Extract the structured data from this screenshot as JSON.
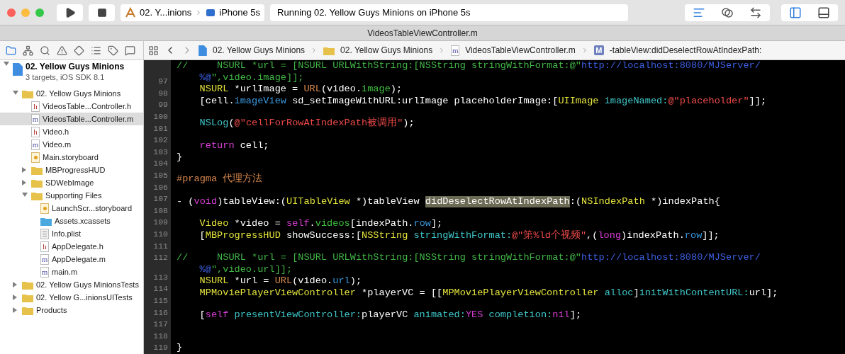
{
  "toolbar": {
    "scheme": "02. Y...inions",
    "device": "iPhone 5s",
    "status": "Running 02. Yellow Guys Minions on iPhone 5s",
    "editor_modes": [
      {
        "kind": "standard",
        "selected": true
      },
      {
        "kind": "assistant",
        "selected": false
      },
      {
        "kind": "version",
        "selected": false
      }
    ],
    "panels": [
      {
        "kind": "navigator",
        "on": true
      },
      {
        "kind": "debug",
        "on": false
      }
    ]
  },
  "window": {
    "title": "VideosTableViewController.m"
  },
  "navigator_tabs": [
    {
      "kind": "project",
      "selected": true
    },
    {
      "kind": "symbols",
      "selected": false
    },
    {
      "kind": "find",
      "selected": false
    },
    {
      "kind": "issues",
      "selected": false
    },
    {
      "kind": "tests",
      "selected": false
    },
    {
      "kind": "debug",
      "selected": false
    },
    {
      "kind": "breakpoints",
      "selected": false
    },
    {
      "kind": "reports",
      "selected": false
    }
  ],
  "project": {
    "name": "02. Yellow Guys Minions",
    "subtitle": "3 targets, iOS SDK 8.1",
    "expanded": true,
    "children": [
      {
        "kind": "folder",
        "name": "02. Yellow Guys Minions",
        "expanded": true,
        "selected": false,
        "children": [
          {
            "kind": "file",
            "letter": "h",
            "name": "VideosTable...Controller.h",
            "selected": false
          },
          {
            "kind": "file",
            "letter": "m",
            "name": "VideosTable...Controller.m",
            "selected": true
          },
          {
            "kind": "file",
            "letter": "h",
            "name": "Video.h",
            "selected": false
          },
          {
            "kind": "file",
            "letter": "m",
            "name": "Video.m",
            "selected": false
          },
          {
            "kind": "storyboard",
            "name": "Main.storyboard",
            "selected": false
          },
          {
            "kind": "folder",
            "name": "MBProgressHUD",
            "expanded": false,
            "selected": false
          },
          {
            "kind": "folder",
            "name": "SDWebImage",
            "expanded": false,
            "selected": false
          },
          {
            "kind": "folder",
            "name": "Supporting Files",
            "expanded": true,
            "selected": false,
            "children": [
              {
                "kind": "storyboard",
                "name": "LaunchScr...storyboard",
                "selected": false
              },
              {
                "kind": "assets",
                "name": "Assets.xcassets",
                "selected": false
              },
              {
                "kind": "plist",
                "name": "Info.plist",
                "selected": false
              },
              {
                "kind": "file",
                "letter": "h",
                "name": "AppDelegate.h",
                "selected": false
              },
              {
                "kind": "file",
                "letter": "m",
                "name": "AppDelegate.m",
                "selected": false
              },
              {
                "kind": "file",
                "letter": "m",
                "name": "main.m",
                "selected": false
              }
            ]
          }
        ]
      },
      {
        "kind": "folder",
        "name": "02. Yellow Guys MinionsTests",
        "expanded": false,
        "selected": false
      },
      {
        "kind": "folder",
        "name": "02. Yellow G...inionsUITests",
        "expanded": false,
        "selected": false
      },
      {
        "kind": "folder",
        "name": "Products",
        "expanded": false,
        "selected": false
      }
    ]
  },
  "jump_bar": [
    {
      "kind": "project",
      "text": "02. Yellow Guys Minions"
    },
    {
      "kind": "folder",
      "text": "02. Yellow Guys Minions"
    },
    {
      "kind": "file",
      "letter": "m",
      "text": "VideosTableViewController.m"
    },
    {
      "kind": "method",
      "letter": "M",
      "text": "-tableView:didDeselectRowAtIndexPath:"
    }
  ],
  "code": [
    {
      "tokens": [
        {
          "kind": "comment",
          "text": "//     NSURL *url = [NSURL URLWithString:[NSString stringWithFormat:@\""
        },
        {
          "kind": "url",
          "text": "http://localhost:8080/MJServer/"
        }
      ],
      "continuation": [
        {
          "kind": "url",
          "text": "%@"
        },
        {
          "kind": "comment",
          "text": "\",video.image]];"
        }
      ]
    },
    {
      "number": "97",
      "indented": true,
      "tokens": [
        {
          "kind": "type",
          "text": "NSURL"
        },
        {
          "kind": "plain",
          "text": " *urlImage = "
        },
        {
          "kind": "macro",
          "text": "URL"
        },
        {
          "kind": "plain",
          "text": "(video."
        },
        {
          "kind": "member",
          "text": "image"
        },
        {
          "kind": "plain",
          "text": ");"
        }
      ]
    },
    {
      "number": "98",
      "indented": true,
      "tokens": [
        {
          "kind": "plain",
          "text": "[cell."
        },
        {
          "kind": "property",
          "text": "imageView"
        },
        {
          "kind": "plain",
          "text": " sd_setImageWithURL:urlImage placeholderImage:["
        },
        {
          "kind": "type",
          "text": "UIImage "
        },
        {
          "kind": "method",
          "text": "imageNamed:"
        },
        {
          "kind": "string",
          "text": "@\"placeholder\""
        },
        {
          "kind": "plain",
          "text": "]];"
        }
      ]
    },
    {
      "number": "99"
    },
    {
      "number": "100",
      "indented": true,
      "tokens": [
        {
          "kind": "method",
          "text": "NSLog"
        },
        {
          "kind": "plain",
          "text": "("
        },
        {
          "kind": "string",
          "text": "@\"cellForRowAtIndexPath被调用\""
        },
        {
          "kind": "plain",
          "text": ");"
        }
      ]
    },
    {
      "number": "101"
    },
    {
      "number": "102",
      "indented": true,
      "tokens": [
        {
          "kind": "keyword",
          "text": "return"
        },
        {
          "kind": "plain",
          "text": " cell;"
        }
      ]
    },
    {
      "number": "103",
      "tokens": [
        {
          "kind": "plain",
          "text": "}"
        }
      ]
    },
    {
      "number": "104"
    },
    {
      "number": "105",
      "tokens": [
        {
          "kind": "pragma",
          "text": "#pragma 代理方法"
        }
      ]
    },
    {
      "number": "106"
    },
    {
      "number": "107",
      "tokens": [
        {
          "kind": "plain",
          "text": "- ("
        },
        {
          "kind": "keyword",
          "text": "void"
        },
        {
          "kind": "plain",
          "text": ")tableView:("
        },
        {
          "kind": "type",
          "text": "UITableView"
        },
        {
          "kind": "plain",
          "text": " *)tableView "
        },
        {
          "kind": "match",
          "text": "didDeselectRowAtIndexPath"
        },
        {
          "kind": "plain",
          "text": ":("
        },
        {
          "kind": "type",
          "text": "NSIndexPath"
        },
        {
          "kind": "plain",
          "text": " *)indexPath{"
        }
      ]
    },
    {
      "number": "108"
    },
    {
      "number": "109",
      "indented": true,
      "tokens": [
        {
          "kind": "type",
          "text": "Video"
        },
        {
          "kind": "plain",
          "text": " *video = "
        },
        {
          "kind": "keyword",
          "text": "self"
        },
        {
          "kind": "plain",
          "text": "."
        },
        {
          "kind": "member",
          "text": "videos"
        },
        {
          "kind": "plain",
          "text": "[indexPath."
        },
        {
          "kind": "property",
          "text": "row"
        },
        {
          "kind": "plain",
          "text": "];"
        }
      ]
    },
    {
      "number": "110",
      "indented": true,
      "tokens": [
        {
          "kind": "plain",
          "text": "["
        },
        {
          "kind": "type",
          "text": "MBProgressHUD"
        },
        {
          "kind": "plain",
          "text": " showSuccess:["
        },
        {
          "kind": "type",
          "text": "NSString "
        },
        {
          "kind": "method",
          "text": "stringWithFormat:"
        },
        {
          "kind": "string",
          "text": "@\"第%ld个视频\""
        },
        {
          "kind": "plain",
          "text": ",("
        },
        {
          "kind": "keyword",
          "text": "long"
        },
        {
          "kind": "plain",
          "text": ")indexPath."
        },
        {
          "kind": "property",
          "text": "row"
        },
        {
          "kind": "plain",
          "text": "]];"
        }
      ]
    },
    {
      "number": "111"
    },
    {
      "number": "112",
      "tokens": [
        {
          "kind": "comment",
          "text": "//     NSURL *url = [NSURL URLWithString:[NSString stringWithFormat:@\""
        },
        {
          "kind": "url",
          "text": "http://localhost:8080/MJServer/"
        }
      ],
      "continuation": [
        {
          "kind": "url",
          "text": "%@"
        },
        {
          "kind": "comment",
          "text": "\",video.url]];"
        }
      ]
    },
    {
      "number": "113",
      "indented": true,
      "tokens": [
        {
          "kind": "type",
          "text": "NSURL"
        },
        {
          "kind": "plain",
          "text": " *url = "
        },
        {
          "kind": "macro",
          "text": "URL"
        },
        {
          "kind": "plain",
          "text": "(video."
        },
        {
          "kind": "property",
          "text": "url"
        },
        {
          "kind": "plain",
          "text": ");"
        }
      ]
    },
    {
      "number": "114",
      "indented": true,
      "tokens": [
        {
          "kind": "type",
          "text": "MPMoviePlayerViewController"
        },
        {
          "kind": "plain",
          "text": " *playerVC = [["
        },
        {
          "kind": "type",
          "text": "MPMoviePlayerViewController "
        },
        {
          "kind": "method",
          "text": "alloc"
        },
        {
          "kind": "plain",
          "text": "]"
        },
        {
          "kind": "method",
          "text": "initWithContentURL:"
        },
        {
          "kind": "plain",
          "text": "url];"
        }
      ]
    },
    {
      "number": "115"
    },
    {
      "number": "116",
      "indented": true,
      "tokens": [
        {
          "kind": "plain",
          "text": "["
        },
        {
          "kind": "keyword",
          "text": "self "
        },
        {
          "kind": "method",
          "text": "presentViewController:"
        },
        {
          "kind": "plain",
          "text": "playerVC "
        },
        {
          "kind": "method",
          "text": "animated:"
        },
        {
          "kind": "keyword",
          "text": "YES "
        },
        {
          "kind": "method",
          "text": "completion:"
        },
        {
          "kind": "keyword",
          "text": "nil"
        },
        {
          "kind": "plain",
          "text": "];"
        }
      ]
    },
    {
      "number": "117"
    },
    {
      "number": "118"
    },
    {
      "number": "119",
      "tokens": [
        {
          "kind": "plain",
          "text": "}"
        }
      ]
    }
  ]
}
